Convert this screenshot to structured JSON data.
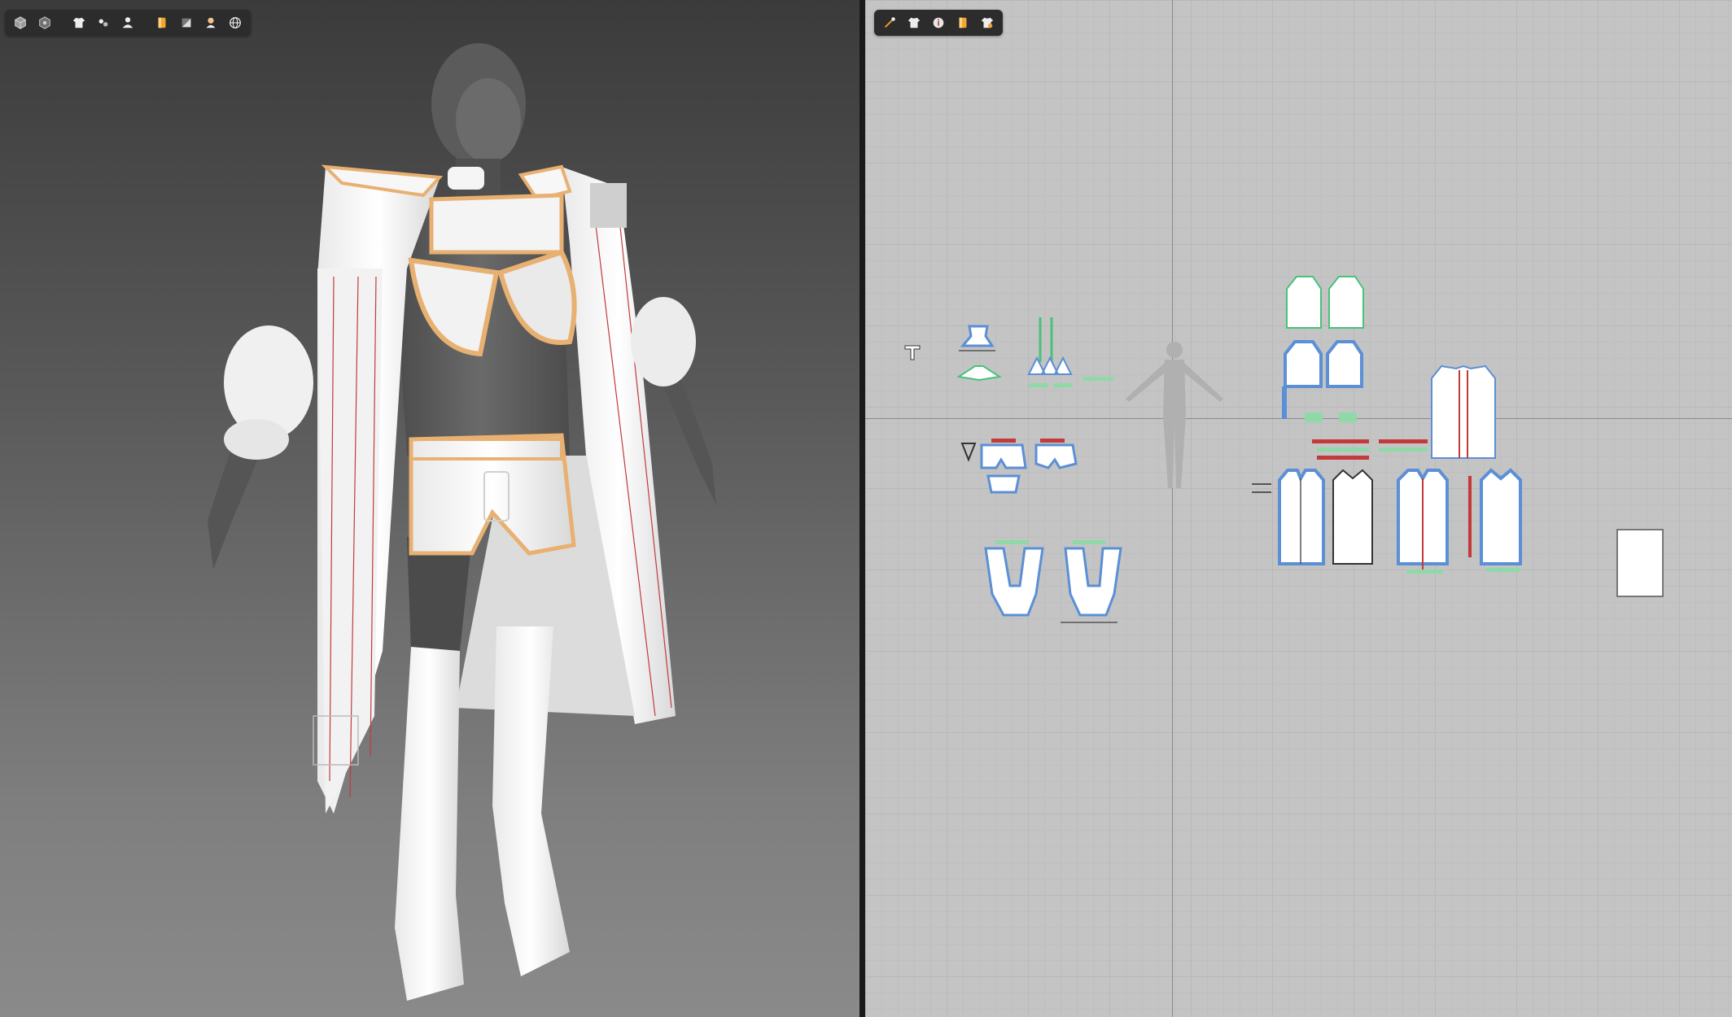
{
  "app": {
    "accent": "#e8b071",
    "seam_color": "#c23a3a",
    "select_color": "#5b8fd6",
    "sew_color": "#48c27a"
  },
  "viewport3d": {
    "toolbar": {
      "groups": [
        [
          {
            "icon": "cube-icon"
          },
          {
            "icon": "texture-cube-icon"
          }
        ],
        [
          {
            "icon": "garment-icon"
          },
          {
            "icon": "hanger-icon"
          },
          {
            "icon": "avatar-icon"
          }
        ],
        [
          {
            "icon": "fabric-icon"
          },
          {
            "icon": "material-icon"
          },
          {
            "icon": "skin-icon"
          },
          {
            "icon": "globe-icon"
          }
        ]
      ]
    }
  },
  "viewport2d": {
    "toolbar": {
      "buttons": [
        {
          "icon": "pin-tool-icon"
        },
        {
          "icon": "garment-icon"
        },
        {
          "icon": "info-icon"
        },
        {
          "icon": "fabric-icon"
        },
        {
          "icon": "reset-garment-icon"
        }
      ]
    },
    "pattern_groups": [
      "top",
      "halter",
      "shorts",
      "boots",
      "coat-sleeves",
      "coat-body",
      "coat-back",
      "blank-piece"
    ]
  }
}
